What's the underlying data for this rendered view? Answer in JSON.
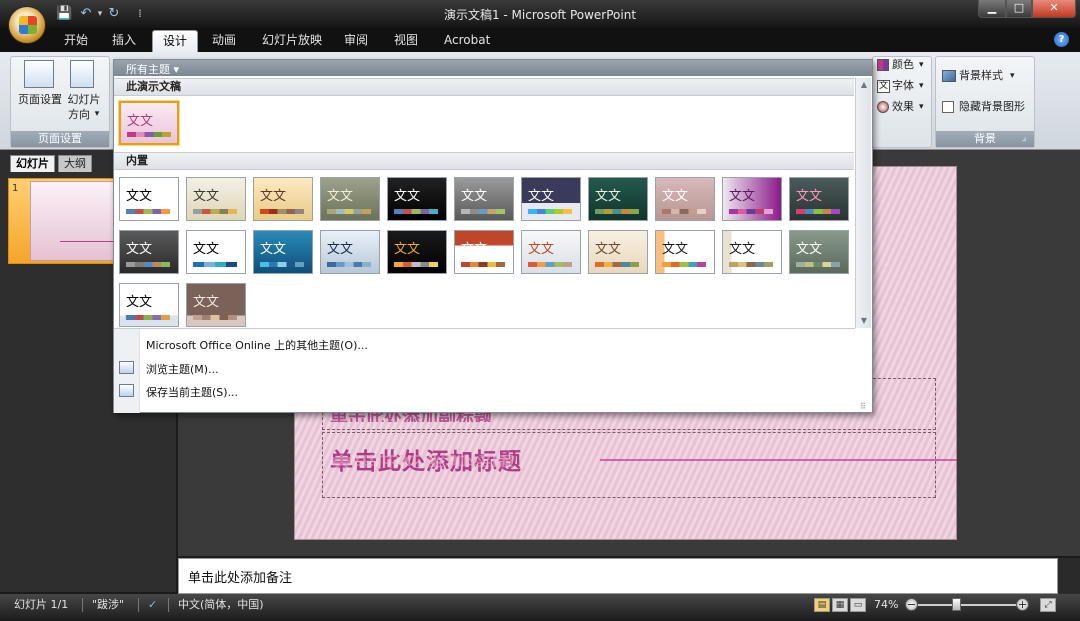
{
  "window": {
    "title": "演示文稿1 - Microsoft PowerPoint",
    "controls": {
      "minimize": "▁",
      "maximize": "□",
      "close": "✕"
    }
  },
  "quick_access": {
    "save": "💾",
    "undo": "↶",
    "undo_arrow": "▾",
    "redo": "↻",
    "customize": "⁞"
  },
  "tabs": [
    {
      "label": "开始",
      "active": false
    },
    {
      "label": "插入",
      "active": false
    },
    {
      "label": "设计",
      "active": true
    },
    {
      "label": "动画",
      "active": false
    },
    {
      "label": "幻灯片放映",
      "active": false
    },
    {
      "label": "审阅",
      "active": false
    },
    {
      "label": "视图",
      "active": false
    },
    {
      "label": "Acrobat",
      "active": false
    }
  ],
  "help_icon": "?",
  "ribbon": {
    "page_setup": {
      "group_label": "页面设置",
      "page_setup_label": "页面设置",
      "orientation_label_1": "幻灯片",
      "orientation_label_2": "方向",
      "orientation_arrow": "▾"
    },
    "theme_options": {
      "colors": "颜色",
      "fonts": "字体",
      "effects": "效果",
      "arrow": "▾",
      "font_glyph": "文"
    },
    "background": {
      "group_label": "背景",
      "styles": "背景样式",
      "hide_graphics": "隐藏背景图形",
      "hide_checked": false,
      "launcher": "⌟"
    }
  },
  "left_panel": {
    "tab_slides": "幻灯片",
    "tab_outline": "大纲",
    "close": "✕",
    "slide_number": "1"
  },
  "slide": {
    "title_placeholder": "单击此处添加标题",
    "subtitle_placeholder": "单击此处添加副标题"
  },
  "notes": {
    "placeholder": "单击此处添加备注"
  },
  "status": {
    "slide_info": "幻灯片 1/1",
    "theme_name": "\"跋涉\"",
    "spell_icon": "✓",
    "language": "中文(简体，中国)",
    "zoom": "74%",
    "zoom_fraction": 0.37,
    "zoom_minus": "−",
    "zoom_plus": "+",
    "view_normal": "▤",
    "view_sorter": "▦",
    "view_show": "▭",
    "fit": "⤢"
  },
  "gallery": {
    "header": "所有主题 ▾",
    "section_this": "此演示文稿",
    "section_builtin": "内置",
    "scroll_up": "▲",
    "scroll_down": "▼",
    "grip": "⠿",
    "current_theme": {
      "label": "文文",
      "bg": "linear-gradient(#fbeaf3,#e9c4d8)",
      "fg": "#b03a82",
      "swatch": "linear-gradient(90deg,#c0398a 0 20%,#e08cb8 20% 40%,#8a5aa8 40% 60%,#6a9a3a 60% 80%,#c0a030 80% 100%)"
    },
    "themes": [
      {
        "label": "文文",
        "bg": "#ffffff",
        "fg": "#000000",
        "swatch": "linear-gradient(90deg,#4f81bd 0 20%,#c0504d 20% 40%,#9bbb59 40% 60%,#8064a2 60% 80%,#f79646 80% 100%)"
      },
      {
        "label": "文文",
        "bg": "linear-gradient(#f4f1e4,#ddd6b8)",
        "fg": "#3a3a2a",
        "swatch": "linear-gradient(90deg,#93a299 0 20%,#cf543f 20% 40%,#b5ae53 40% 60%,#848058 60% 80%,#e8b54d 80% 100%)"
      },
      {
        "label": "文文",
        "bg": "linear-gradient(#fbe9c0,#eacb88)",
        "fg": "#5a3a1a",
        "swatch": "linear-gradient(90deg,#d34817 0 20%,#9b2d1f 20% 40%,#a28e6a 40% 60%,#956251 60% 80%,#918485 80% 100%)"
      },
      {
        "label": "文文",
        "bg": "linear-gradient(#9ea28a,#6c715a)",
        "fg": "#f4f0d8",
        "swatch": "linear-gradient(90deg,#a9a57c 0 20%,#9cbebd 20% 40%,#d2cb6c 40% 60%,#95a39d 60% 80%,#c89f5d 80% 100%)"
      },
      {
        "label": "文文",
        "bg": "linear-gradient(#222,#000)",
        "fg": "#ffffff",
        "swatch": "linear-gradient(90deg,#4f81bd 0 20%,#c0504d 20% 40%,#9bbb59 40% 60%,#8064a2 60% 80%,#4bacc6 80% 100%)"
      },
      {
        "label": "文文",
        "bg": "linear-gradient(#9a9a9a,#5a5a5a)",
        "fg": "#ffffff",
        "swatch": "linear-gradient(90deg,#b7b7b7 0 20%,#8c8c8c 20% 40%,#6a9ac8 40% 60%,#c8a06a 60% 80%,#a0c86a 80% 100%)"
      },
      {
        "label": "文文",
        "bg": "linear-gradient(#3a3a5a 0 60%,#e8e8f0 60% 100%)",
        "fg": "#ffffff",
        "swatch": "linear-gradient(90deg,#31b6fd 0 20%,#4584d3 20% 40%,#5bd078 40% 60%,#a5d028 60% 80%,#f5c040 80% 100%)"
      },
      {
        "label": "文文",
        "bg": "linear-gradient(#24594e,#0f352c)",
        "fg": "#e8f4e8",
        "swatch": "linear-gradient(90deg,#6f9c5e 0 20%,#b39b3e 20% 40%,#4e8f89 40% 60%,#c48a3a 60% 80%,#8aa84a 80% 100%)"
      },
      {
        "label": "文文",
        "bg": "linear-gradient(#d8b8b8,#b89696)",
        "fg": "#ffffff",
        "swatch": "linear-gradient(90deg,#a57c6a 0 20%,#d6b8a4 20% 40%,#8a6a5a 40% 60%,#c89a8a 60% 80%,#e8d0c0 80% 100%)"
      },
      {
        "label": "文文",
        "bg": "linear-gradient(90deg,#f0e8f0,#8a1a8a)",
        "fg": "#5a1a5a",
        "swatch": "linear-gradient(90deg,#a03aa0 0 20%,#e05aa0 20% 40%,#6a3aa0 40% 60%,#c03a6a 60% 80%,#e8a0d0 80% 100%)"
      },
      {
        "label": "文文",
        "bg": "linear-gradient(#4a5a5a,#2a3434)",
        "fg": "#ff9ab8",
        "swatch": "linear-gradient(90deg,#e03a6a 0 20%,#4a8ac0 20% 40%,#8ac04a 40% 60%,#c08a4a 60% 80%,#a04ac0 80% 100%)"
      },
      {
        "label": "文文",
        "bg": "linear-gradient(#5a5a5a,#2a2a2a)",
        "fg": "#ffffff",
        "swatch": "linear-gradient(90deg,#9a9a9a 0 20%,#7a7a7a 20% 40%,#5a8aba 40% 60%,#ba8a5a 60% 80%,#8aba5a 80% 100%)"
      },
      {
        "label": "文文",
        "bg": "#ffffff",
        "fg": "#000000",
        "swatch": "linear-gradient(90deg,#1e6fc0 0 25%,#7ab0e0 25% 50%,#2ab0c0 50% 75%,#1a4a8a 75% 100%)"
      },
      {
        "label": "文文",
        "bg": "linear-gradient(#2a8ab8,#0f4f7a)",
        "fg": "#ffffff",
        "swatch": "linear-gradient(90deg,#4ac0e0 0 20%,#2a7ab0 20% 40%,#8ad0e8 40% 60%,#1a5a8a 60% 80%,#60a0c0 80% 100%)"
      },
      {
        "label": "文文",
        "bg": "linear-gradient(#e8f0f8,#b8c8d8)",
        "fg": "#1a2a4a",
        "swatch": "linear-gradient(90deg,#3a6aa0 0 20%,#6a9ac8 20% 40%,#a0c0e0 40% 60%,#4a7ab0 60% 80%,#8ab0d0 80% 100%)"
      },
      {
        "label": "文文",
        "bg": "linear-gradient(#1a1a1a,#000)",
        "fg": "#f0a830",
        "swatch": "linear-gradient(90deg,#f0a830 0 20%,#e05a2a 20% 40%,#c0c0c0 40% 60%,#8a8a8a 60% 80%,#f0d060 80% 100%)"
      },
      {
        "label": "文文",
        "bg": "linear-gradient(#c0462a 0 35%,#ffffff 35% 100%)",
        "fg": "#ffffff",
        "swatch": "linear-gradient(90deg,#c0462a 0 20%,#e08a3a 20% 40%,#8a3a2a 40% 60%,#e0c03a 60% 80%,#a06a3a 80% 100%)"
      },
      {
        "label": "文文",
        "bg": "linear-gradient(#f8f8f8,#d8e0e8)",
        "fg": "#c0462a",
        "swatch": "linear-gradient(90deg,#e05a3a 0 20%,#f0a040 20% 40%,#60a0c0 40% 60%,#a0c060 60% 80%,#c0a080 80% 100%)"
      },
      {
        "label": "文文",
        "bg": "linear-gradient(#f8f0e0,#e8d8c0)",
        "fg": "#6a4a2a",
        "swatch": "linear-gradient(90deg,#e06a2a 0 20%,#f0b040 20% 40%,#a06a4a 40% 60%,#4a8aa0 60% 80%,#8aa04a 80% 100%)"
      },
      {
        "label": "文文",
        "bg": "linear-gradient(90deg,#f8c080 0 15%,#ffffff 15% 100%)",
        "fg": "#1a1a1a",
        "swatch": "linear-gradient(90deg,#f0a040 0 20%,#e06a2a 20% 40%,#a0c040 40% 60%,#40a0c0 60% 80%,#c040a0 80% 100%)"
      },
      {
        "label": "文文",
        "bg": "linear-gradient(90deg,#e8e0d0 0 15%,#ffffff 15% 100%)",
        "fg": "#1a1a1a",
        "swatch": "linear-gradient(90deg,#c0a060 0 20%,#e0c080 20% 40%,#8a6a4a 40% 60%,#6a8aa0 60% 80%,#a0a060 80% 100%)"
      },
      {
        "label": "文文",
        "bg": "linear-gradient(#8a9a8a,#5a6a5a)",
        "fg": "#ffffff",
        "swatch": "linear-gradient(90deg,#a0b0a0 0 20%,#c0c080 20% 40%,#6a8a6a 40% 60%,#e0d0a0 60% 80%,#8aa0b0 80% 100%)"
      },
      {
        "label": "文文",
        "bg": "linear-gradient(#ffffff 0 75%,#d8e4f0 75% 100%)",
        "fg": "#000000",
        "swatch": "linear-gradient(90deg,#4a7ab0 0 20%,#c04a4a 20% 40%,#8ab04a 40% 60%,#8a6ab0 60% 80%,#e0a040 80% 100%)"
      },
      {
        "label": "文文",
        "bg": "linear-gradient(#7a6258 0 75%,#d8c8c0 75% 100%)",
        "fg": "#f4e8e0",
        "swatch": "linear-gradient(90deg,#c0a090 0 20%,#a08070 20% 40%,#e0c0a0 40% 60%,#806050 60% 80%,#b09080 80% 100%)"
      }
    ],
    "menu": [
      "Microsoft Office Online 上的其他主题(O)...",
      "浏览主题(M)...",
      "保存当前主题(S)..."
    ]
  }
}
